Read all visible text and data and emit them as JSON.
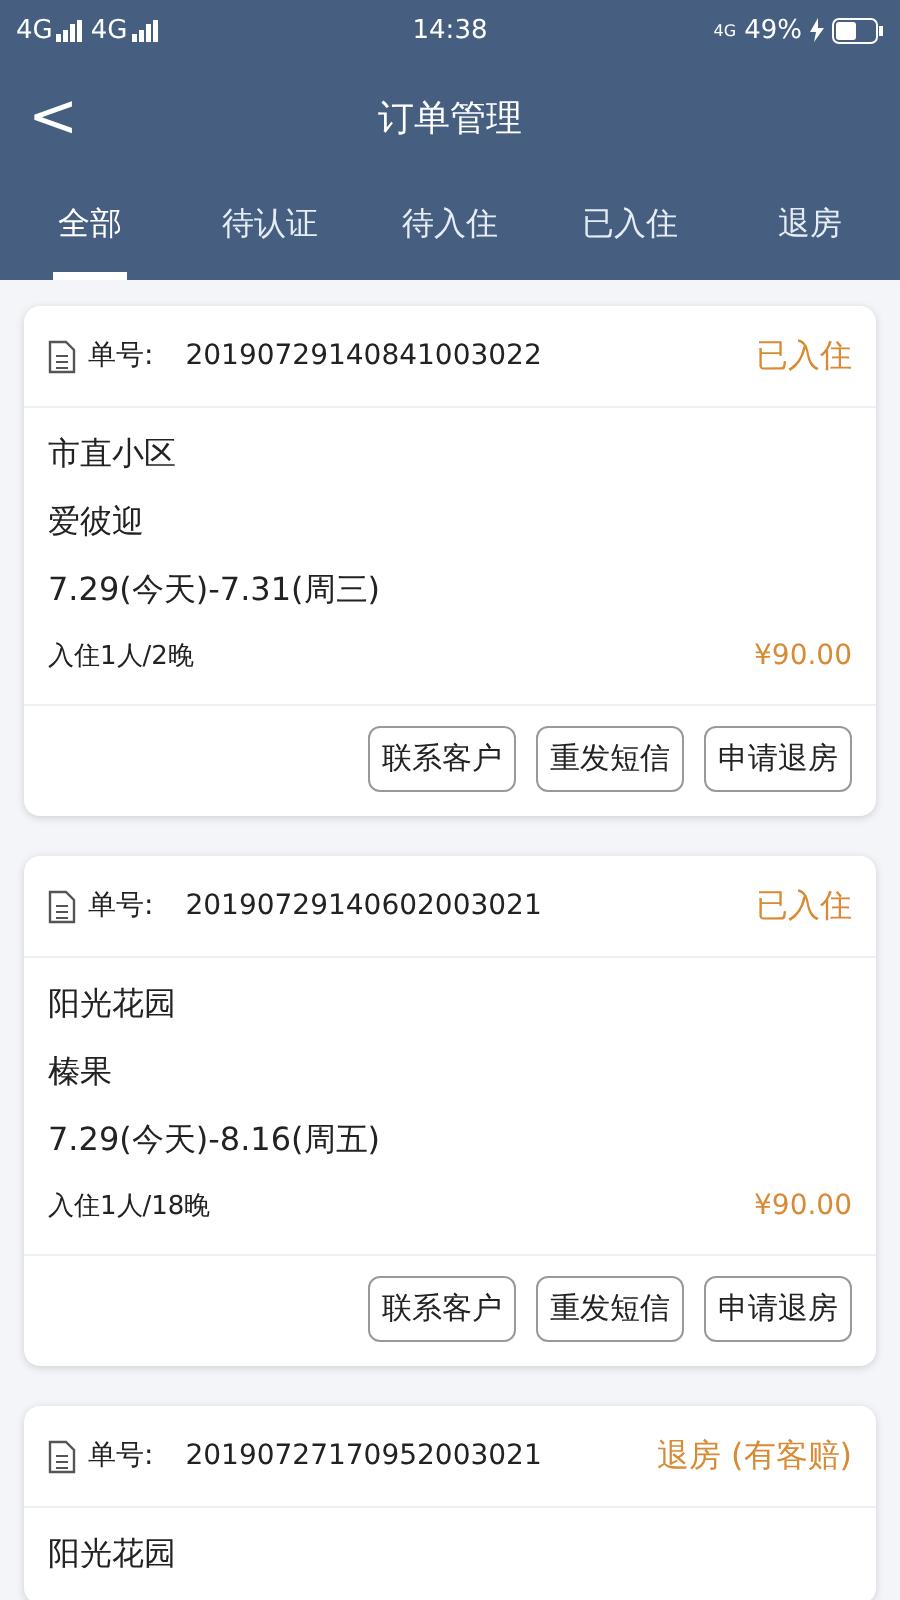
{
  "status_bar": {
    "signals": [
      "4G",
      "4G"
    ],
    "time": "14:38",
    "network": "4G",
    "battery": "49%"
  },
  "nav": {
    "back": "<",
    "title": "订单管理"
  },
  "tabs": [
    {
      "label": "全部",
      "selected": true
    },
    {
      "label": "待认证",
      "selected": false
    },
    {
      "label": "待入住",
      "selected": false
    },
    {
      "label": "已入住",
      "selected": false
    },
    {
      "label": "退房",
      "selected": false
    }
  ],
  "orders": [
    {
      "number_label": "单号:",
      "number": "20190729140841003022",
      "status": "已入住",
      "community": "市直小区",
      "room": "爱彼迎",
      "dates": "7.29(今天)-7.31(周三)",
      "guests": "入住1人/2晚",
      "price": "¥90.00",
      "actions": [
        "联系客户",
        "重发短信",
        "申请退房"
      ]
    },
    {
      "number_label": "单号:",
      "number": "20190729140602003021",
      "status": "已入住",
      "community": "阳光花园",
      "room": "榛果",
      "dates": "7.29(今天)-8.16(周五)",
      "guests": "入住1人/18晚",
      "price": "¥90.00",
      "actions": [
        "联系客户",
        "重发短信",
        "申请退房"
      ]
    },
    {
      "number_label": "单号:",
      "number": "20190727170952003021",
      "status": "退房 (有客赔)",
      "community": "阳光花园"
    }
  ]
}
